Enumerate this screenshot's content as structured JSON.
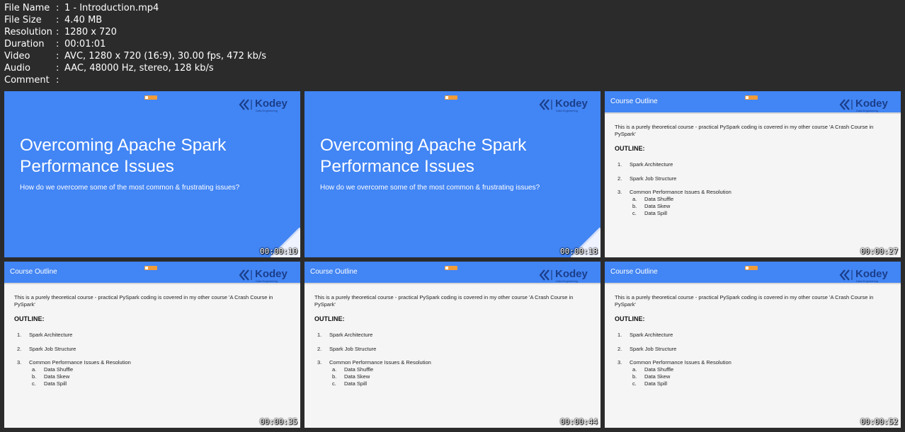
{
  "file_info": [
    {
      "key": "File Name",
      "value": "1 - Introduction.mp4"
    },
    {
      "key": "File Size",
      "value": "4.40 MB"
    },
    {
      "key": "Resolution",
      "value": "1280 x 720"
    },
    {
      "key": "Duration",
      "value": "00:01:01"
    },
    {
      "key": "Video",
      "value": "AVC, 1280 x 720 (16:9), 30.00 fps, 472 kb/s"
    },
    {
      "key": "Audio",
      "value": "AAC, 48000 Hz, stereo, 128 kb/s"
    },
    {
      "key": "Comment",
      "value": ""
    }
  ],
  "separator": ":",
  "brand": {
    "name": "Kodey",
    "tagline": "Data Engineering",
    "color": "#1a3e8a"
  },
  "colors": {
    "background": "#2b2b2b",
    "slide_blue": "#4285f4",
    "badge": "#f29c38"
  },
  "title_slide": {
    "title": "Overcoming Apache Spark Performance Issues",
    "subtitle": "How do we overcome some of the most common & frustrating issues?"
  },
  "outline_slide": {
    "header": "Course Outline",
    "intro": "This is a purely theoretical course - practical PySpark coding is covered in my other course 'A Crash Course in PySpark'",
    "label": "OUTLINE:",
    "items": [
      {
        "num": "1.",
        "text": "Spark Architecture"
      },
      {
        "num": "2.",
        "text": "Spark Job Structure"
      },
      {
        "num": "3.",
        "text": "Common Performance Issues & Resolution"
      }
    ],
    "subitems": [
      {
        "num": "a.",
        "text": "Data Shuffle"
      },
      {
        "num": "b.",
        "text": "Data Skew"
      },
      {
        "num": "c.",
        "text": "Data Spill"
      }
    ]
  },
  "thumbnails": [
    {
      "type": "title",
      "time": "00:00:10"
    },
    {
      "type": "title",
      "time": "00:00:18"
    },
    {
      "type": "outline",
      "time": "00:00:27"
    },
    {
      "type": "outline",
      "time": "00:00:35"
    },
    {
      "type": "outline",
      "time": "00:00:44"
    },
    {
      "type": "outline",
      "time": "00:00:52"
    }
  ]
}
